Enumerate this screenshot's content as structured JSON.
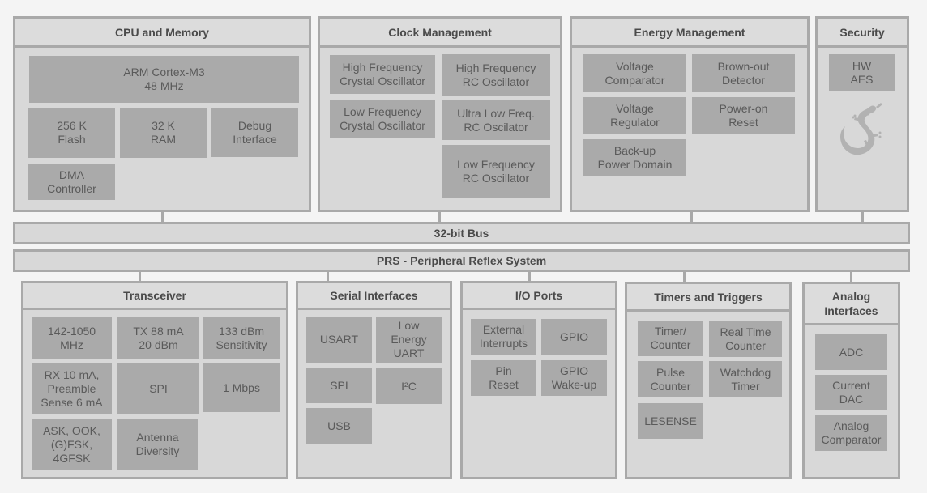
{
  "groups": {
    "cpu": {
      "title": "CPU and Memory",
      "blocks": [
        "ARM Cortex-M3\n48 MHz",
        "256 K\nFlash",
        "32 K\nRAM",
        "Debug\nInterface",
        "DMA\nController"
      ]
    },
    "clock": {
      "title": "Clock Management",
      "blocks": [
        "High Frequency\nCrystal Oscillator",
        "High Frequency\nRC Oscillator",
        "Low Frequency\nCrystal Oscillator",
        "Ultra Low Freq.\nRC Oscilator",
        "Low Frequency\nRC Oscillator"
      ]
    },
    "energy": {
      "title": "Energy Management",
      "blocks": [
        "Voltage\nComparator",
        "Brown-out\nDetector",
        "Voltage\nRegulator",
        "Power-on\nReset",
        "Back-up\nPower Domain"
      ]
    },
    "security": {
      "title": "Security",
      "blocks": [
        "HW\nAES"
      ],
      "logo": "gecko-icon"
    },
    "transceiver": {
      "title": "Transceiver",
      "blocks": [
        "142-1050\nMHz",
        "TX 88 mA\n20 dBm",
        "133 dBm\nSensitivity",
        "RX 10 mA,\nPreamble\nSense 6 mA",
        "SPI",
        "1 Mbps",
        "ASK, OOK,\n(G)FSK,\n4GFSK",
        "Antenna\nDiversity"
      ]
    },
    "serial": {
      "title": "Serial Interfaces",
      "blocks": [
        "USART",
        "Low\nEnergy\nUART",
        "SPI",
        "I²C",
        "USB"
      ]
    },
    "io": {
      "title": "I/O Ports",
      "blocks": [
        "External\nInterrupts",
        "GPIO",
        "Pin\nReset",
        "GPIO\nWake-up"
      ]
    },
    "timers": {
      "title": "Timers and Triggers",
      "blocks": [
        "Timer/\nCounter",
        "Real Time\nCounter",
        "Pulse\nCounter",
        "Watchdog\nTimer",
        "LESENSE"
      ]
    },
    "analog": {
      "title": "Analog\nInterfaces",
      "blocks": [
        "ADC",
        "Current\nDAC",
        "Analog\nComparator"
      ]
    }
  },
  "bus": {
    "label": "32-bit Bus"
  },
  "prs": {
    "label": "PRS - Peripheral Reflex System"
  }
}
